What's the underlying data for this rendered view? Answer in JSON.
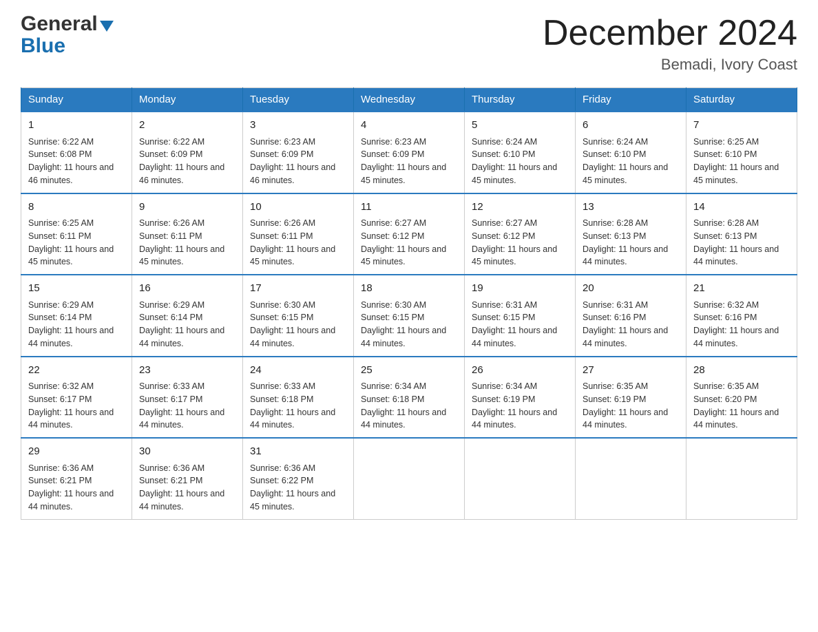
{
  "logo": {
    "general": "General",
    "blue": "Blue"
  },
  "title": "December 2024",
  "subtitle": "Bemadi, Ivory Coast",
  "days": [
    "Sunday",
    "Monday",
    "Tuesday",
    "Wednesday",
    "Thursday",
    "Friday",
    "Saturday"
  ],
  "weeks": [
    [
      {
        "day": "1",
        "sunrise": "6:22 AM",
        "sunset": "6:08 PM",
        "daylight": "11 hours and 46 minutes."
      },
      {
        "day": "2",
        "sunrise": "6:22 AM",
        "sunset": "6:09 PM",
        "daylight": "11 hours and 46 minutes."
      },
      {
        "day": "3",
        "sunrise": "6:23 AM",
        "sunset": "6:09 PM",
        "daylight": "11 hours and 46 minutes."
      },
      {
        "day": "4",
        "sunrise": "6:23 AM",
        "sunset": "6:09 PM",
        "daylight": "11 hours and 45 minutes."
      },
      {
        "day": "5",
        "sunrise": "6:24 AM",
        "sunset": "6:10 PM",
        "daylight": "11 hours and 45 minutes."
      },
      {
        "day": "6",
        "sunrise": "6:24 AM",
        "sunset": "6:10 PM",
        "daylight": "11 hours and 45 minutes."
      },
      {
        "day": "7",
        "sunrise": "6:25 AM",
        "sunset": "6:10 PM",
        "daylight": "11 hours and 45 minutes."
      }
    ],
    [
      {
        "day": "8",
        "sunrise": "6:25 AM",
        "sunset": "6:11 PM",
        "daylight": "11 hours and 45 minutes."
      },
      {
        "day": "9",
        "sunrise": "6:26 AM",
        "sunset": "6:11 PM",
        "daylight": "11 hours and 45 minutes."
      },
      {
        "day": "10",
        "sunrise": "6:26 AM",
        "sunset": "6:11 PM",
        "daylight": "11 hours and 45 minutes."
      },
      {
        "day": "11",
        "sunrise": "6:27 AM",
        "sunset": "6:12 PM",
        "daylight": "11 hours and 45 minutes."
      },
      {
        "day": "12",
        "sunrise": "6:27 AM",
        "sunset": "6:12 PM",
        "daylight": "11 hours and 45 minutes."
      },
      {
        "day": "13",
        "sunrise": "6:28 AM",
        "sunset": "6:13 PM",
        "daylight": "11 hours and 44 minutes."
      },
      {
        "day": "14",
        "sunrise": "6:28 AM",
        "sunset": "6:13 PM",
        "daylight": "11 hours and 44 minutes."
      }
    ],
    [
      {
        "day": "15",
        "sunrise": "6:29 AM",
        "sunset": "6:14 PM",
        "daylight": "11 hours and 44 minutes."
      },
      {
        "day": "16",
        "sunrise": "6:29 AM",
        "sunset": "6:14 PM",
        "daylight": "11 hours and 44 minutes."
      },
      {
        "day": "17",
        "sunrise": "6:30 AM",
        "sunset": "6:15 PM",
        "daylight": "11 hours and 44 minutes."
      },
      {
        "day": "18",
        "sunrise": "6:30 AM",
        "sunset": "6:15 PM",
        "daylight": "11 hours and 44 minutes."
      },
      {
        "day": "19",
        "sunrise": "6:31 AM",
        "sunset": "6:15 PM",
        "daylight": "11 hours and 44 minutes."
      },
      {
        "day": "20",
        "sunrise": "6:31 AM",
        "sunset": "6:16 PM",
        "daylight": "11 hours and 44 minutes."
      },
      {
        "day": "21",
        "sunrise": "6:32 AM",
        "sunset": "6:16 PM",
        "daylight": "11 hours and 44 minutes."
      }
    ],
    [
      {
        "day": "22",
        "sunrise": "6:32 AM",
        "sunset": "6:17 PM",
        "daylight": "11 hours and 44 minutes."
      },
      {
        "day": "23",
        "sunrise": "6:33 AM",
        "sunset": "6:17 PM",
        "daylight": "11 hours and 44 minutes."
      },
      {
        "day": "24",
        "sunrise": "6:33 AM",
        "sunset": "6:18 PM",
        "daylight": "11 hours and 44 minutes."
      },
      {
        "day": "25",
        "sunrise": "6:34 AM",
        "sunset": "6:18 PM",
        "daylight": "11 hours and 44 minutes."
      },
      {
        "day": "26",
        "sunrise": "6:34 AM",
        "sunset": "6:19 PM",
        "daylight": "11 hours and 44 minutes."
      },
      {
        "day": "27",
        "sunrise": "6:35 AM",
        "sunset": "6:19 PM",
        "daylight": "11 hours and 44 minutes."
      },
      {
        "day": "28",
        "sunrise": "6:35 AM",
        "sunset": "6:20 PM",
        "daylight": "11 hours and 44 minutes."
      }
    ],
    [
      {
        "day": "29",
        "sunrise": "6:36 AM",
        "sunset": "6:21 PM",
        "daylight": "11 hours and 44 minutes."
      },
      {
        "day": "30",
        "sunrise": "6:36 AM",
        "sunset": "6:21 PM",
        "daylight": "11 hours and 44 minutes."
      },
      {
        "day": "31",
        "sunrise": "6:36 AM",
        "sunset": "6:22 PM",
        "daylight": "11 hours and 45 minutes."
      },
      null,
      null,
      null,
      null
    ]
  ]
}
